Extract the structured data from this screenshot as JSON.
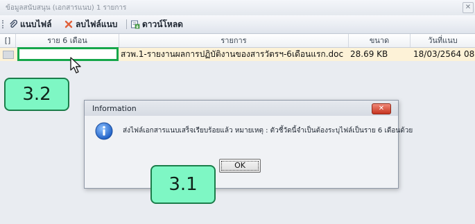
{
  "panel": {
    "title": "ข้อมูลสนับสนุน (เอกสารแนบ) 1 รายการ",
    "close_glyph": "✕"
  },
  "toolbar": {
    "attach_label": "แนบไฟล์",
    "attach_icon": "paperclip-icon",
    "delete_label": "ลบไฟล์แนบ",
    "delete_icon": "delete-x-icon",
    "download_label": "ดาวน์โหลด",
    "download_icon": "download-icon"
  },
  "grid": {
    "columns": [
      "[]",
      "ราย 6 เดือน",
      "รายการ",
      "ขนาด",
      "วันที่แนบ"
    ],
    "rows": [
      {
        "period": "",
        "item": "สวพ.1-รายงานผลการปฏิบัติงานของสารวัตรฯ-6เดือนแรก.doc",
        "size": "28.69 KB",
        "date": "18/03/2564 08"
      }
    ]
  },
  "callouts": {
    "step_a": "3.2",
    "step_b": "3.1"
  },
  "dialog": {
    "title": "Information",
    "close_glyph": "✕",
    "message": "ส่งไฟล์เอกสารแนบเสร็จเรียบร้อยแล้ว  หมายเหตุ : ตัวชี้วัดนี้จำเป็นต้องระบุไฟล์เป็นราย 6 เดือนด้วย",
    "ok_label": "OK",
    "icon": "info-icon"
  },
  "colors": {
    "highlight_border": "#15a64a",
    "callout_fill": "#7ef7c4",
    "row_highlight": "#fdf2d7",
    "dialog_close": "#c6341f",
    "info_icon": "#2b6fd6"
  }
}
